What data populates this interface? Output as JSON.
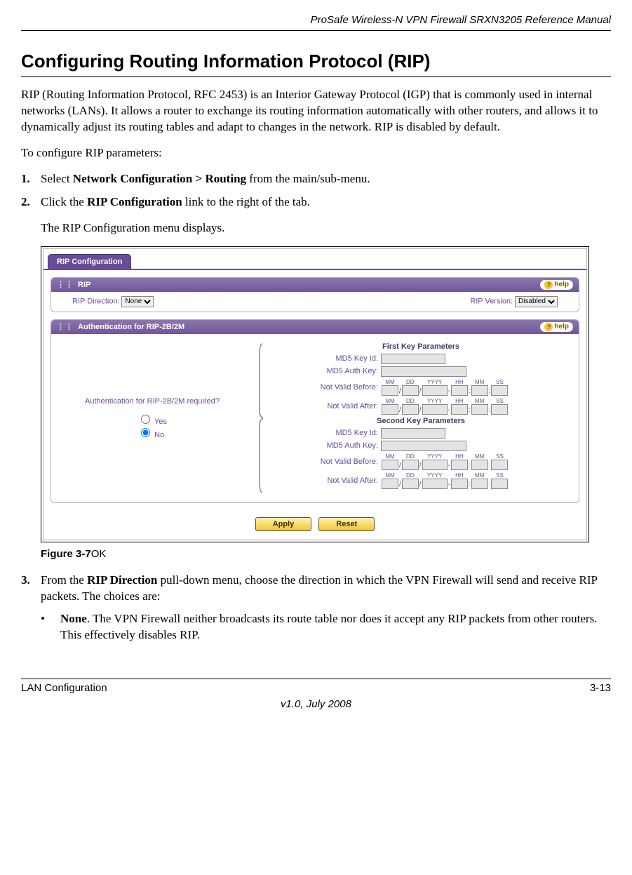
{
  "header": {
    "doc_title": "ProSafe Wireless-N VPN Firewall SRXN3205 Reference Manual"
  },
  "section": {
    "title": "Configuring Routing Information Protocol (RIP)"
  },
  "intro": "RIP (Routing Information Protocol, RFC 2453) is an Interior Gateway Protocol (IGP) that is commonly used in internal networks (LANs). It allows a router to exchange its routing information automatically with other routers, and allows it to dynamically adjust its routing tables and adapt to changes in the network. RIP is disabled by default.",
  "lead": "To configure RIP parameters:",
  "steps": {
    "s1_pre": "Select ",
    "s1_b": "Network Configuration > Routing",
    "s1_post": " from the main/sub-menu.",
    "s2_pre": "Click the ",
    "s2_b": "RIP Configuration",
    "s2_post": " link to the right of the tab.",
    "s2_follow": "The RIP Configuration menu displays.",
    "s3_pre": "From the ",
    "s3_b": "RIP Direction",
    "s3_post": " pull-down menu, choose the direction in which the VPN Firewall will send and receive RIP packets. The choices are:"
  },
  "ui": {
    "tab": "RIP Configuration",
    "panel_rip": "RIP",
    "help": "help",
    "rip_direction_label": "RIP Direction:",
    "rip_direction_value": "None",
    "rip_version_label": "RIP Version:",
    "rip_version_value": "Disabled",
    "panel_auth": "Authentication for RIP-2B/2M",
    "auth_required": "Authentication for RIP-2B/2M required?",
    "yes": "Yes",
    "no": "No",
    "first_key": "First Key Parameters",
    "second_key": "Second Key Parameters",
    "md5_id": "MD5 Key Id:",
    "md5_auth": "MD5 Auth Key:",
    "nvb": "Not Valid Before:",
    "nva": "Not Valid After:",
    "dt": {
      "MM": "MM",
      "DD": "DD",
      "YYYY": "YYYY",
      "HH": "HH",
      "SS": "SS"
    },
    "apply": "Apply",
    "reset": "Reset"
  },
  "figure": {
    "label": "Figure 3-7",
    "suffix": "OK"
  },
  "bullet_none": {
    "b": "None",
    "txt": ". The VPN Firewall neither broadcasts its route table nor does it accept any RIP packets from other routers. This effectively disables RIP."
  },
  "footer": {
    "left": "LAN Configuration",
    "right": "3-13",
    "center": "v1.0, July 2008"
  }
}
